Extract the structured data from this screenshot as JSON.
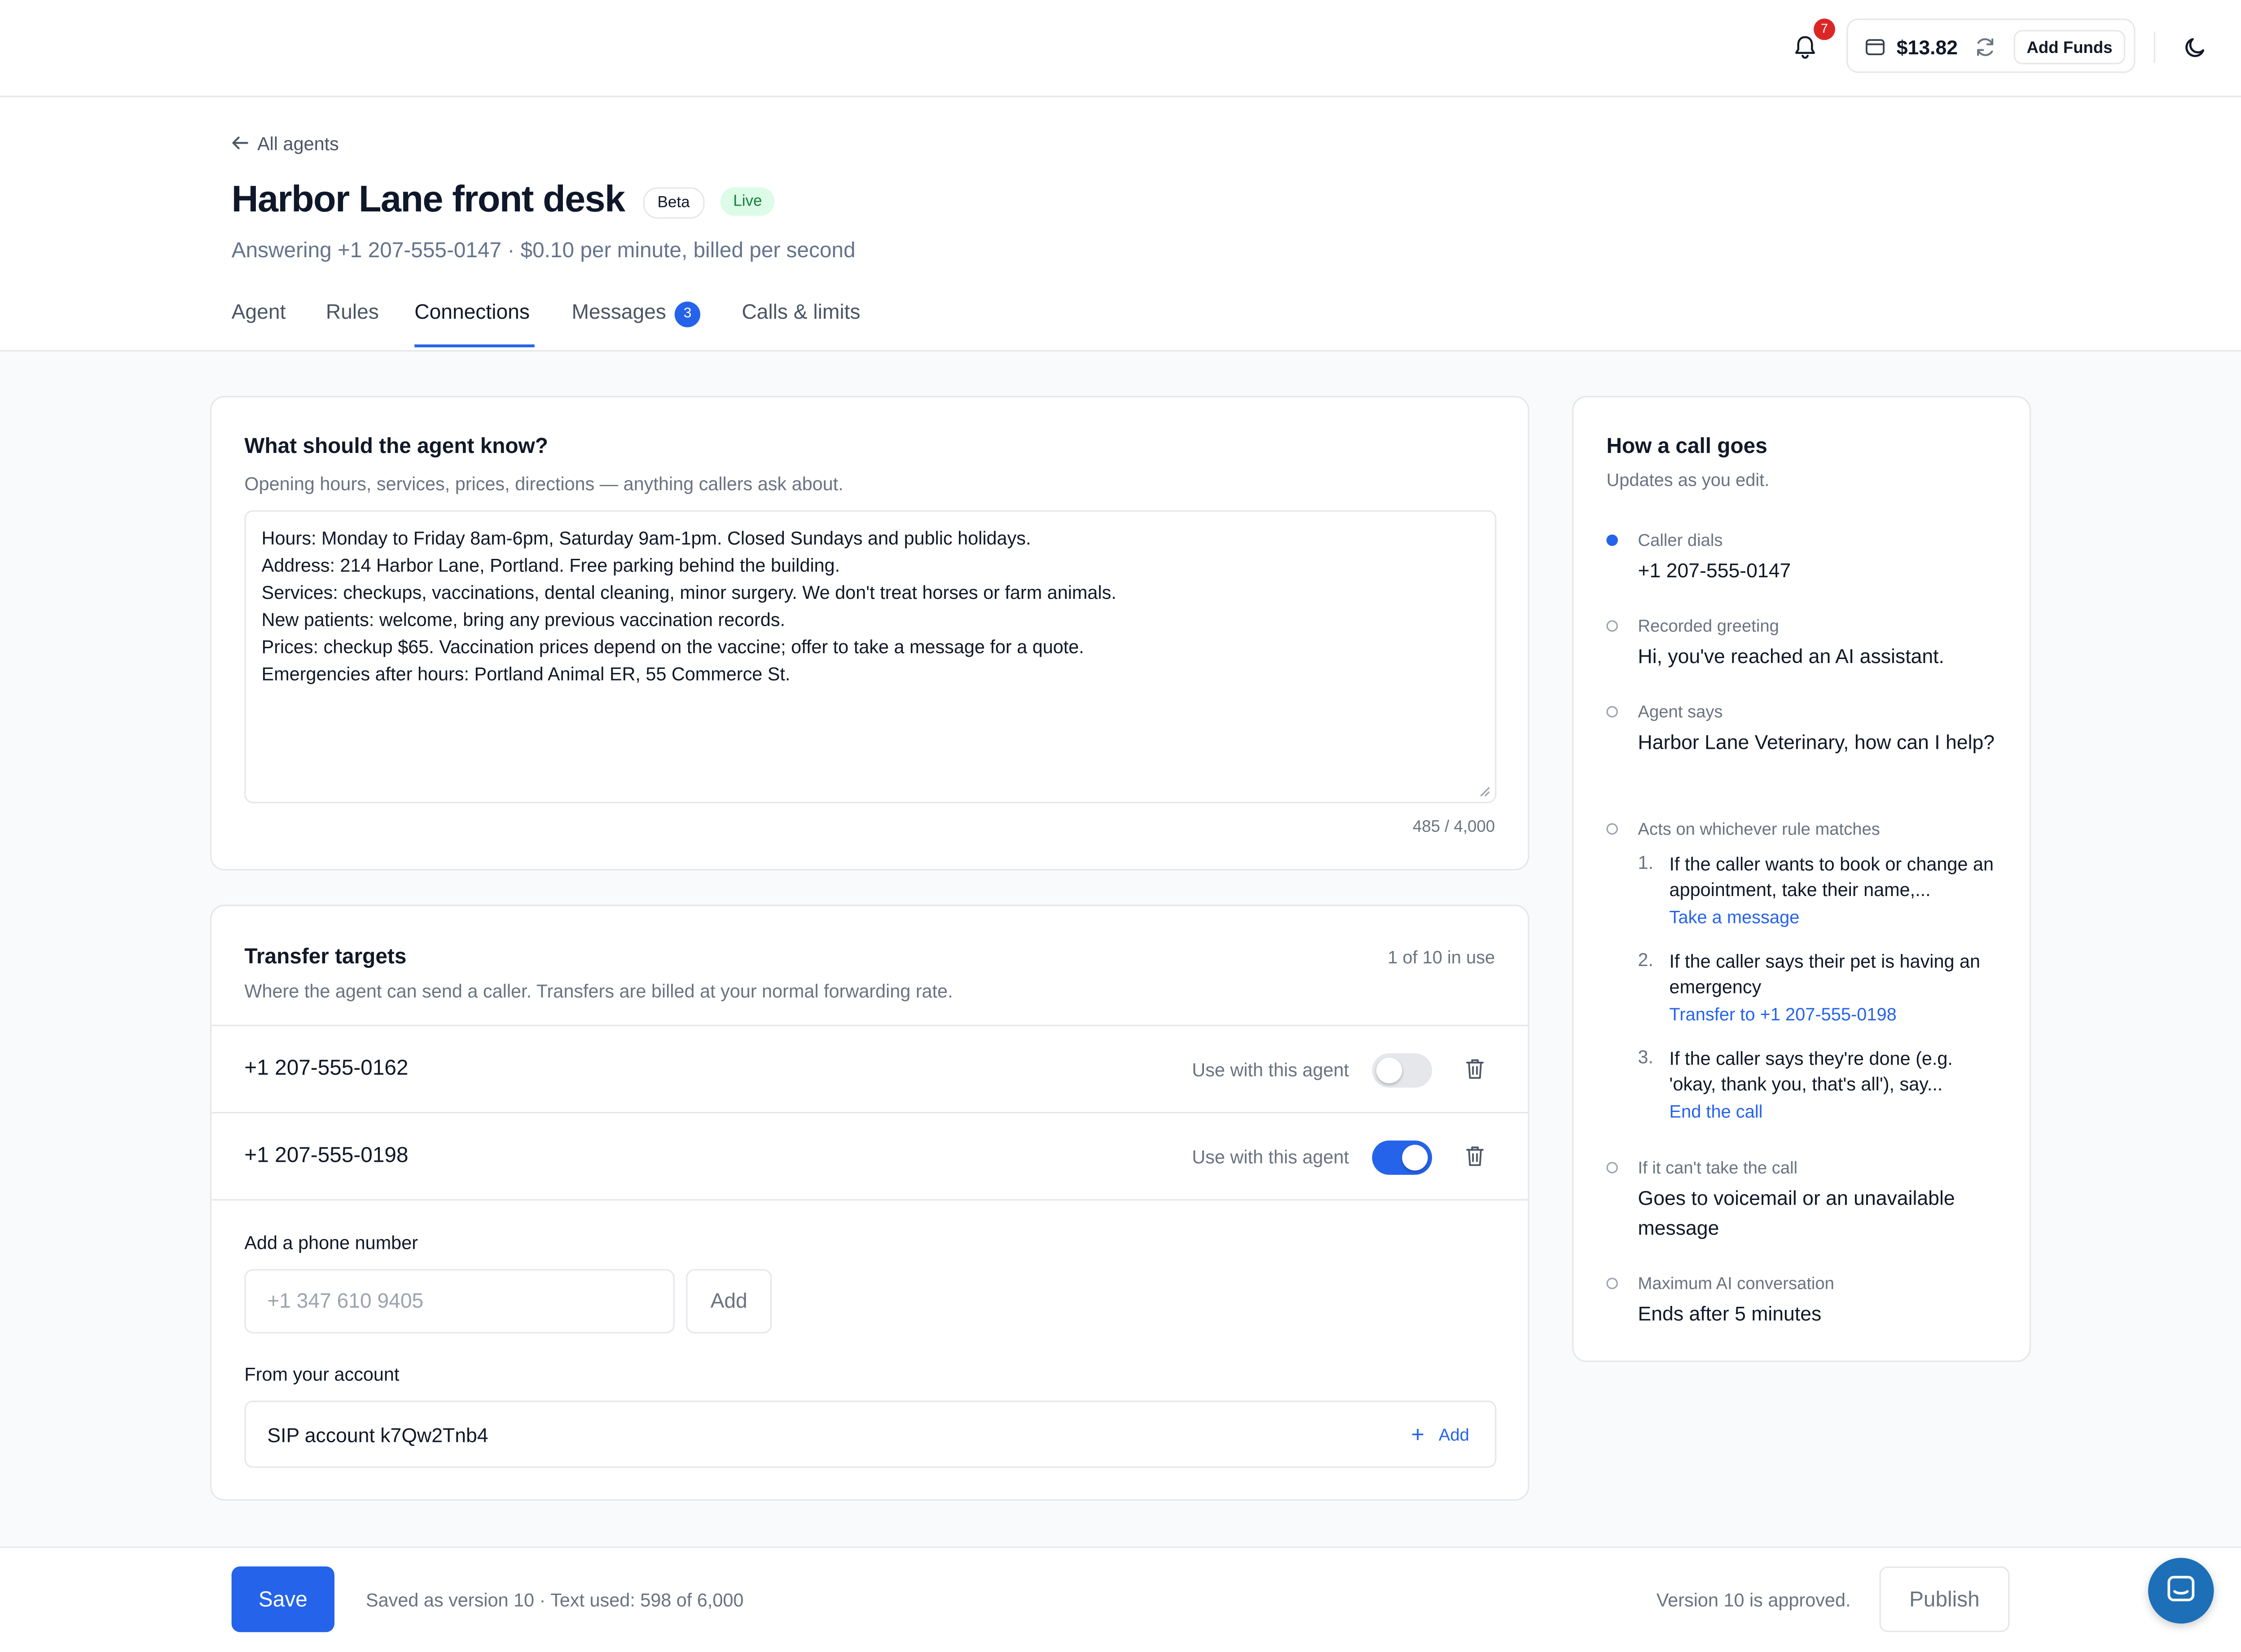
{
  "topbar": {
    "notifications_count": "7",
    "balance": "$13.82",
    "add_funds_label": "Add Funds"
  },
  "header": {
    "back_label": "All agents",
    "title": "Harbor Lane front desk",
    "badge_beta": "Beta",
    "badge_live": "Live",
    "subtitle": "Answering +1 207-555-0147 · $0.10 per minute, billed per second",
    "tabs": [
      {
        "label": "Agent"
      },
      {
        "label": "Rules"
      },
      {
        "label": "Connections"
      },
      {
        "label": "Messages",
        "badge": "3"
      },
      {
        "label": "Calls & limits"
      }
    ],
    "active_tab": "Connections"
  },
  "knowledge": {
    "title": "What should the agent know?",
    "subtitle": "Opening hours, services, prices, directions — anything callers ask about.",
    "lines": [
      "Hours: Monday to Friday 8am-6pm, Saturday 9am-1pm. Closed Sundays and public holidays.",
      "Address: 214 Harbor Lane, Portland. Free parking behind the building.",
      "Services: checkups, vaccinations, dental cleaning, minor surgery. We don't treat horses or farm animals.",
      "New patients: welcome, bring any previous vaccination records.",
      "Prices: checkup $65. Vaccination prices depend on the vaccine; offer to take a message for a quote.",
      "Emergencies after hours: Portland Animal ER, 55 Commerce St."
    ],
    "counter": "485 / 4,000"
  },
  "transfer": {
    "title": "Transfer targets",
    "subtitle": "Where the agent can send a caller. Transfers are billed at your normal forwarding rate.",
    "in_use": "1 of 10 in use",
    "targets": [
      {
        "number": "+1 207-555-0162",
        "use_label": "Use with this agent",
        "enabled": false
      },
      {
        "number": "+1 207-555-0198",
        "use_label": "Use with this agent",
        "enabled": true
      }
    ],
    "add_phone_label": "Add a phone number",
    "phone_placeholder": "+1 347 610 9405",
    "add_button": "Add",
    "from_account_label": "From your account",
    "sip_account": "SIP account k7Qw2Tnb4",
    "sip_add": "Add"
  },
  "call_flow": {
    "title": "How a call goes",
    "subtitle": "Updates as you edit.",
    "steps": [
      {
        "label": "Caller dials",
        "value": "+1 207-555-0147"
      },
      {
        "label": "Recorded greeting",
        "value": "Hi, you've reached an AI assistant."
      },
      {
        "label": "Agent says",
        "value": "Harbor Lane Veterinary, how can I help?"
      },
      {
        "label": "Acts on whichever rule matches"
      },
      {
        "label": "If it can't take the call",
        "value": "Goes to voicemail or an unavailable message"
      },
      {
        "label": "Maximum AI conversation",
        "value": "Ends after 5 minutes"
      }
    ],
    "rules": [
      {
        "index": "1.",
        "text": "If the caller wants to book or change an appointment, take their name,...",
        "action": "Take a message"
      },
      {
        "index": "2.",
        "text": "If the caller says their pet is having an emergency",
        "action": "Transfer to +1 207-555-0198"
      },
      {
        "index": "3.",
        "text": "If the caller says they're done (e.g. 'okay, thank you, that's all'), say...",
        "action": "End the call"
      }
    ]
  },
  "footer": {
    "save_label": "Save",
    "saved_text": "Saved as version 10 · Text used: 598 of 6,000",
    "approved_text": "Version 10 is approved.",
    "publish_label": "Publish"
  },
  "colors": {
    "accent": "#2563eb",
    "live_badge_bg": "#dcfce7",
    "live_badge_text": "#15803d",
    "notification_badge": "#dc2626"
  }
}
